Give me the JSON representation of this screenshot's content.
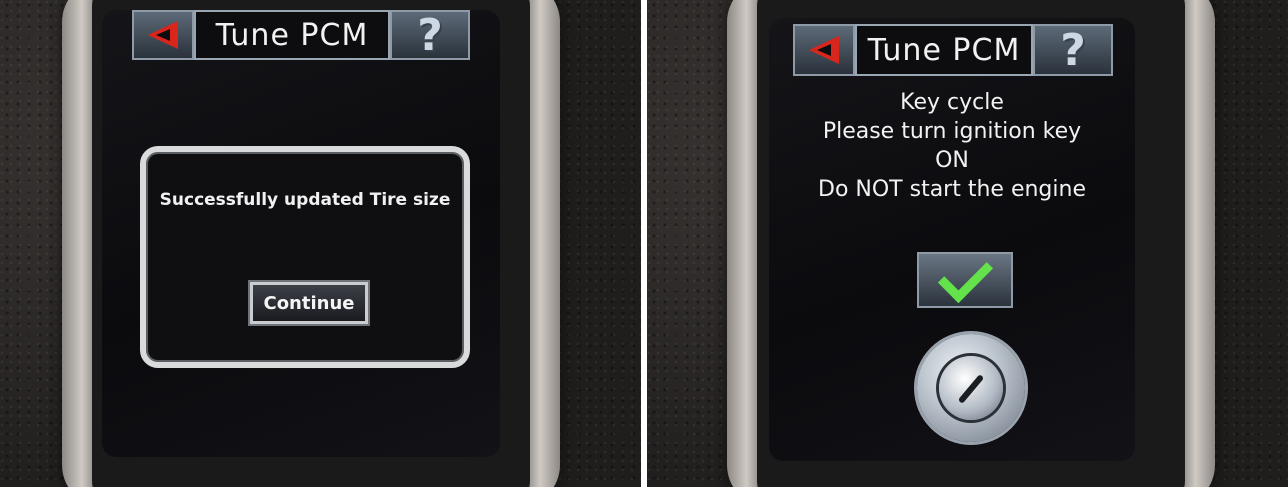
{
  "left_panel": {
    "title": "Tune PCM",
    "back_icon": "back-arrow-icon",
    "help_icon": "question-mark-icon",
    "help_glyph": "?",
    "message": "Successfully updated Tire size",
    "button": "Continue"
  },
  "right_panel": {
    "title": "Tune PCM",
    "back_icon": "back-arrow-icon",
    "help_icon": "question-mark-icon",
    "help_glyph": "?",
    "lines": [
      "Key cycle",
      "Please turn ignition key",
      "ON",
      "Do NOT start the engine"
    ],
    "confirm_icon": "checkmark-icon",
    "ignition_icon": "ignition-key-icon"
  },
  "colors": {
    "back_arrow": "#d9261c",
    "checkmark": "#63e24b",
    "screen_bg": "#0d0d10"
  }
}
